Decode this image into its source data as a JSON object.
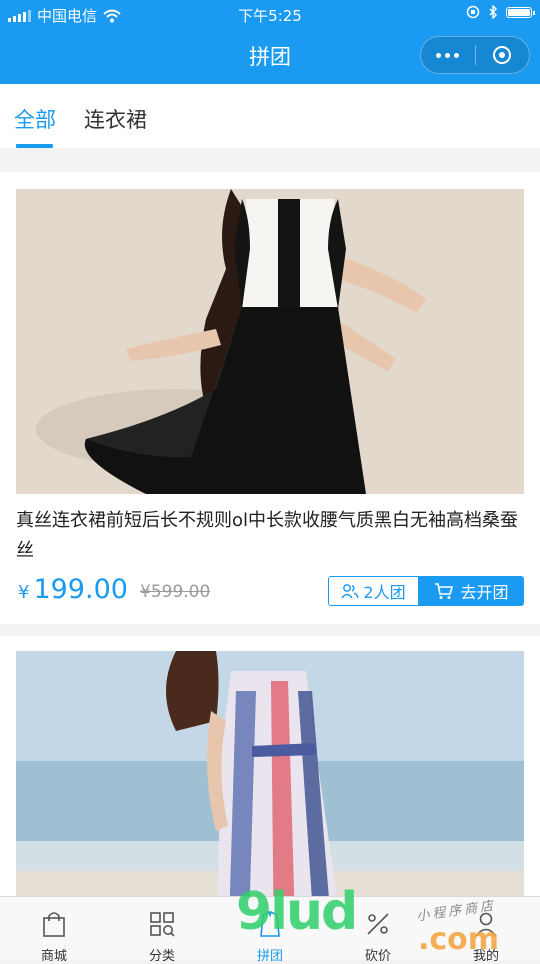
{
  "status_bar": {
    "carrier": "中国电信",
    "time": "下午5:25"
  },
  "navbar": {
    "title": "拼团"
  },
  "tabs": [
    {
      "label": "全部",
      "active": true
    },
    {
      "label": "连衣裙",
      "active": false
    }
  ],
  "products": [
    {
      "title": "真丝连衣裙前短后长不规则ol中长款收腰气质黑白无袖高档桑蚕丝",
      "currency": "¥",
      "price": "199.00",
      "original_price": "¥599.00",
      "group_size_label": "2人团",
      "open_group_label": "去开团"
    },
    {
      "title": "",
      "currency": "",
      "price": "",
      "original_price": "",
      "group_size_label": "",
      "open_group_label": ""
    }
  ],
  "tabbar": [
    {
      "label": "商城",
      "icon": "shop-bag-icon"
    },
    {
      "label": "分类",
      "icon": "category-grid-icon"
    },
    {
      "label": "拼团",
      "icon": "group-buy-icon",
      "active": true
    },
    {
      "label": "砍价",
      "icon": "bargain-icon"
    },
    {
      "label": "我的",
      "icon": "user-icon"
    }
  ],
  "watermark": {
    "main": "9lud",
    "suffix": ".com",
    "tagline": "小程序商店"
  },
  "colors": {
    "primary": "#1a9af0",
    "price": "#1a9af0",
    "strike": "#9a9a9a"
  }
}
